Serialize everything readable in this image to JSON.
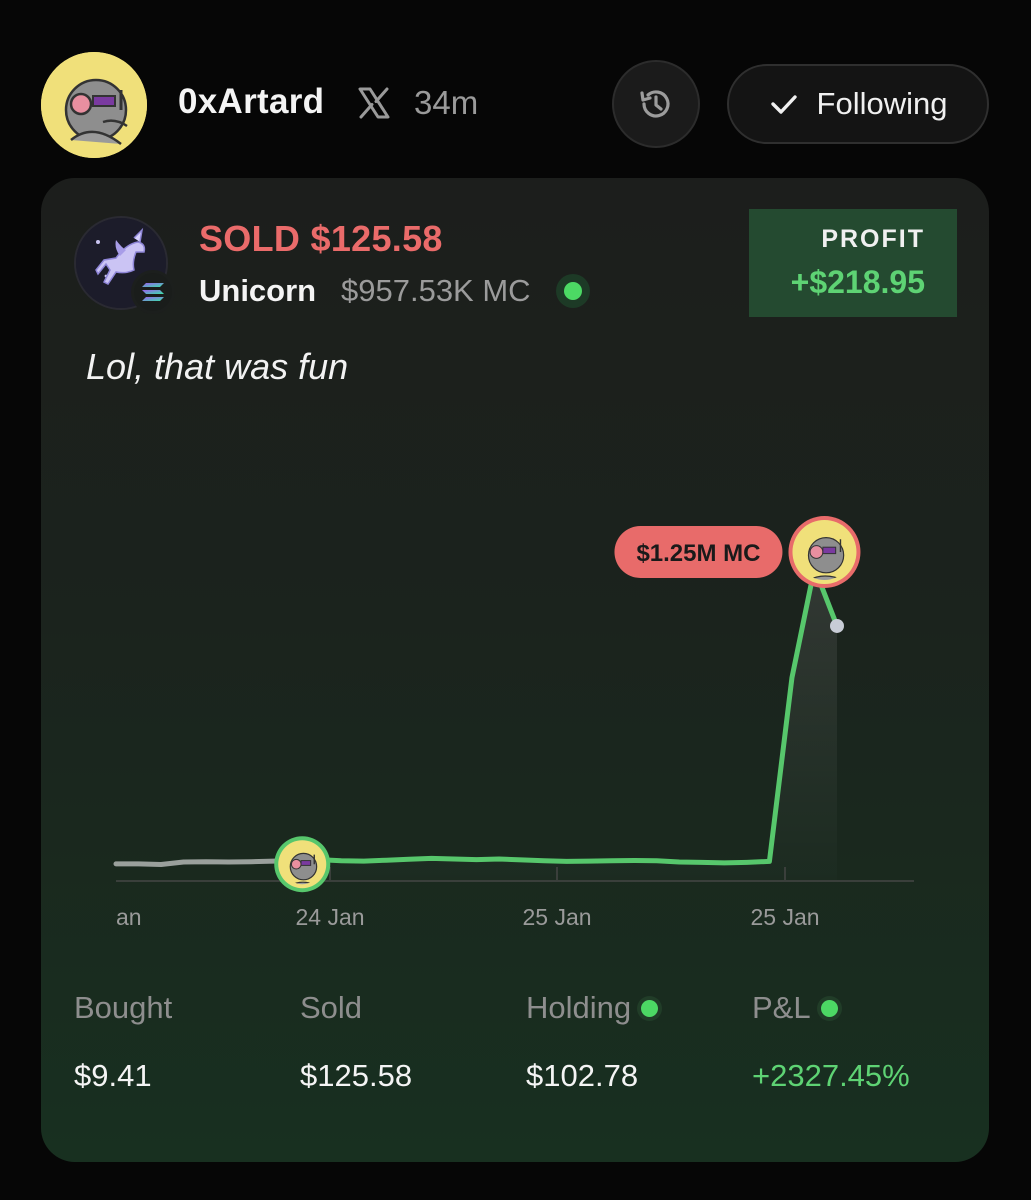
{
  "header": {
    "username": "0xArtard",
    "time_ago": "34m",
    "following_label": "Following"
  },
  "trade": {
    "title": "SOLD $125.58",
    "token_name": "Unicorn",
    "market_cap": "$957.53K MC",
    "profit_label": "PROFIT",
    "profit_value": "+$218.95",
    "comment": "Lol, that was fun"
  },
  "chart_data": {
    "type": "line",
    "x_tick_labels": [
      "an",
      "24 Jan",
      "25 Jan",
      "25 Jan"
    ],
    "peak_label": "$1.25M MC",
    "series": [
      {
        "values": [
          3.0,
          3.0,
          2.8,
          3.6,
          3.7,
          3.6,
          3.7,
          3.9,
          4.2,
          4.4,
          4.0,
          3.9,
          4.2,
          4.5,
          4.8,
          4.6,
          4.4,
          4.6,
          4.3,
          4.0,
          3.8,
          3.9,
          4.0,
          4.1,
          4.0,
          3.6,
          3.5,
          3.3,
          3.5,
          3.8,
          64.0,
          100,
          81.0
        ]
      }
    ],
    "buy_point_index": 8,
    "sell_point_index": 31,
    "colors": {
      "pre_buy": "#9aa09c",
      "holding": "#57c76c",
      "peak_badge": "#e86b6a"
    }
  },
  "stats": [
    {
      "label": "Bought",
      "value": "$9.41",
      "dot": false,
      "positive": false
    },
    {
      "label": "Sold",
      "value": "$125.58",
      "dot": false,
      "positive": false
    },
    {
      "label": "Holding",
      "value": "$102.78",
      "dot": true,
      "positive": false
    },
    {
      "label": "P&L",
      "value": "+2327.45%",
      "dot": true,
      "positive": true
    }
  ],
  "icons": {
    "platform": "x-logo-icon",
    "history": "history-clock-icon",
    "check": "checkmark-icon",
    "chain": "solana-icon"
  }
}
